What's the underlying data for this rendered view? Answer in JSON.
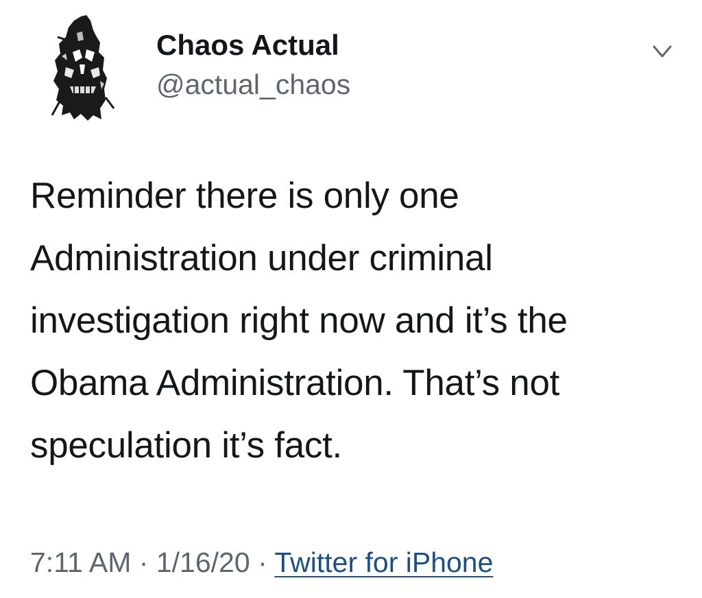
{
  "author": {
    "display_name": "Chaos Actual",
    "handle": "@actual_chaos",
    "avatar_icon": "skull-avatar-icon"
  },
  "menu": {
    "icon": "chevron-down-icon"
  },
  "tweet": {
    "lines": [
      "Reminder there is only one",
      "Administration under criminal",
      "investigation right now and it’s the",
      "Obama Administration. That’s not",
      "speculation it’s fact."
    ]
  },
  "meta": {
    "time": "7:11 AM",
    "separator": "·",
    "date": "1/16/20",
    "source": "Twitter for iPhone"
  },
  "colors": {
    "text": "#14171a",
    "secondary": "#5b6670",
    "link": "#1b4f8a"
  }
}
